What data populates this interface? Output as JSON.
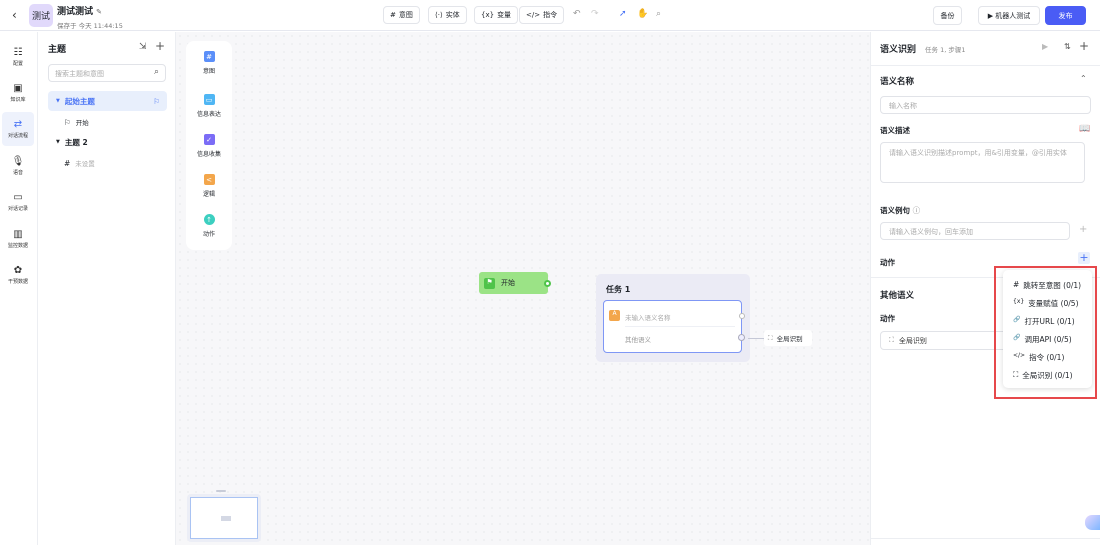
{
  "header": {
    "avatar_text": "测试",
    "title": "测试测试",
    "saved": "保存于 今天 11:44:15",
    "tools": [
      {
        "icon": "#",
        "label": "意图"
      },
      {
        "icon": "⟨·⟩",
        "label": "实体"
      },
      {
        "icon": "{x}",
        "label": "变量"
      },
      {
        "icon": "</>",
        "label": "指令"
      }
    ],
    "backup": "备份",
    "robot_test": "机器人测试",
    "publish": "发布"
  },
  "nav": [
    {
      "label": "配置",
      "icon": "☷"
    },
    {
      "label": "知识库",
      "icon": "▣"
    },
    {
      "label": "对话流程",
      "icon": "⇄"
    },
    {
      "label": "语音",
      "icon": "🎙"
    },
    {
      "label": "对话记录",
      "icon": "▭"
    },
    {
      "label": "监控数据",
      "icon": "▥"
    },
    {
      "label": "干预数据",
      "icon": "✿"
    }
  ],
  "topics": {
    "title": "主题",
    "search_placeholder": "搜索主题和意图",
    "items": [
      {
        "label": "起始主题"
      },
      {
        "label": "开始"
      },
      {
        "label": "主题 2"
      },
      {
        "label": "未设置"
      }
    ]
  },
  "palette": [
    {
      "label": "意图",
      "icon": "#",
      "color": "#5b8ff9"
    },
    {
      "label": "信息表达",
      "icon": "▭",
      "color": "#4fb6f4"
    },
    {
      "label": "信息收集",
      "icon": "✓",
      "color": "#7b6cf6"
    },
    {
      "label": "逻辑",
      "icon": "<",
      "color": "#f3a64b"
    },
    {
      "label": "动作",
      "icon": "↑",
      "color": "#3ccfc0"
    }
  ],
  "canvas": {
    "start_node": "开始",
    "task_title": "任务 1",
    "semantic_placeholder": "未输入语义名称",
    "other_semantic": "其他语义",
    "global_recognition": "全局识别"
  },
  "panel": {
    "title": "语义识别",
    "subtitle": "任务 1, 步骤1",
    "name_section": "语义名称",
    "name_placeholder": "输入名称",
    "desc_label": "语义描述",
    "desc_placeholder": "请输入语义识别描述prompt，用&引用变量，@引用实体",
    "example_label": "语义例句",
    "example_placeholder": "请输入语义例句，回车添加",
    "action_label": "动作",
    "other_section": "其他语义",
    "other_action_label": "动作",
    "other_action_value": "全局识别"
  },
  "action_menu": [
    {
      "icon": "#",
      "label": "跳转至意图 (0/1)"
    },
    {
      "icon": "{x}",
      "label": "变量赋值 (0/5)"
    },
    {
      "icon": "🔗",
      "label": "打开URL (0/1)"
    },
    {
      "icon": "🔗",
      "label": "调用API (0/5)"
    },
    {
      "icon": "</>",
      "label": "指令 (0/1)"
    },
    {
      "icon": "⛶",
      "label": "全局识别 (0/1)"
    }
  ]
}
